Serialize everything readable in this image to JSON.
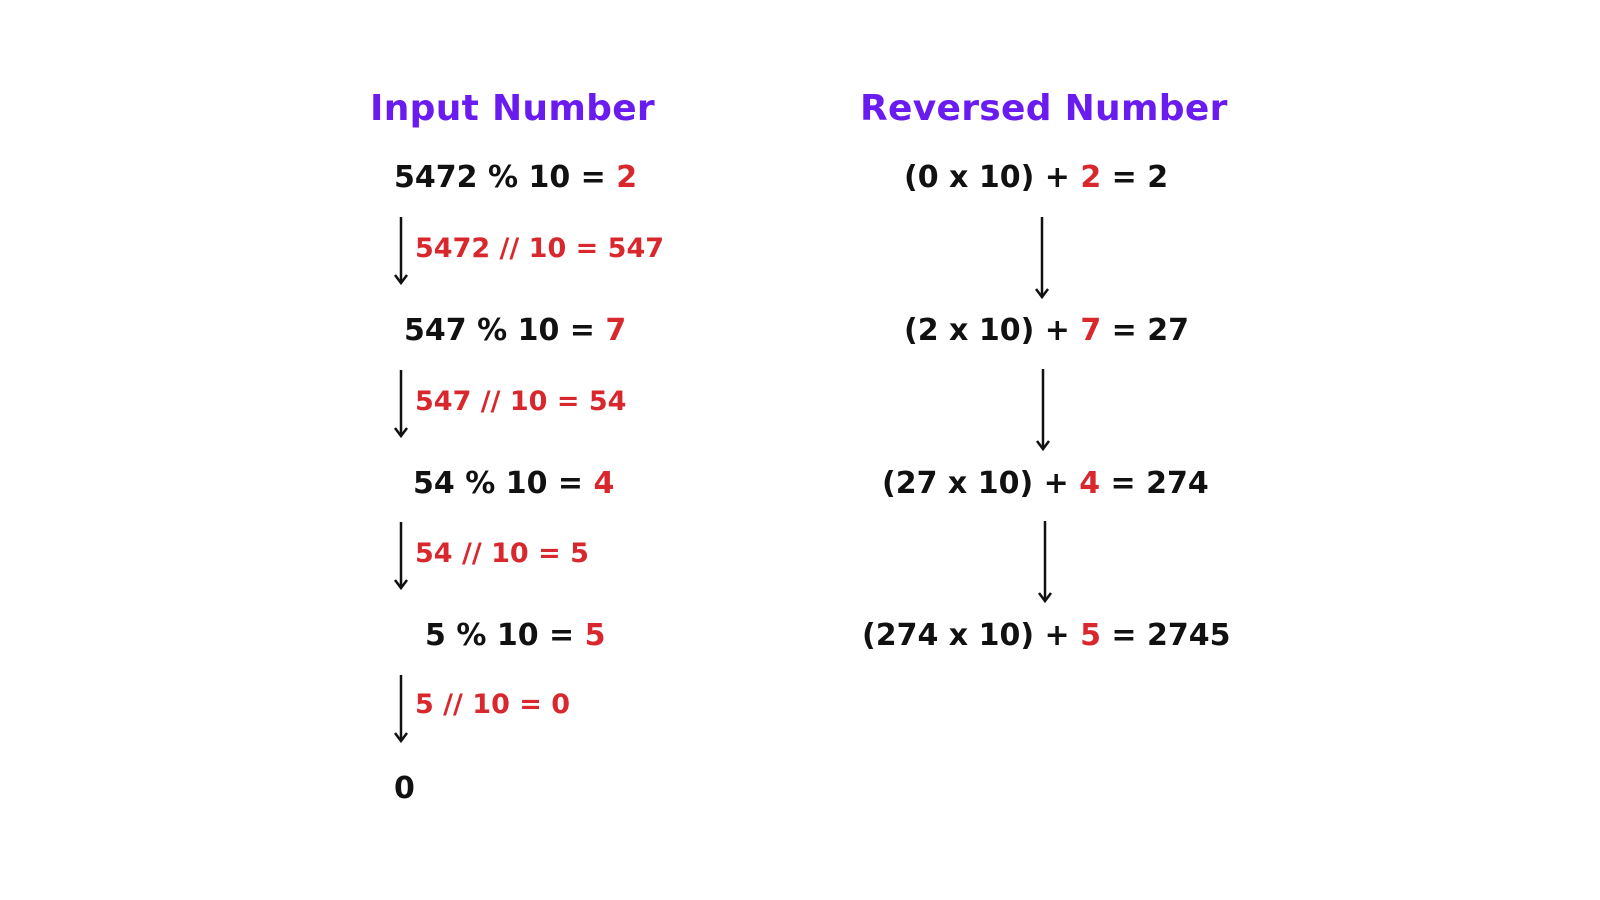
{
  "left": {
    "title": "Input Number",
    "steps": [
      {
        "expr": "5472 % 10 = ",
        "digit": "2",
        "division": "5472 // 10 = 547"
      },
      {
        "expr": "547 % 10 = ",
        "digit": "7",
        "division": "547 // 10 = 54"
      },
      {
        "expr": "54 % 10 = ",
        "digit": "4",
        "division": "54 // 10 = 5"
      },
      {
        "expr": "5 % 10 = ",
        "digit": "5",
        "division": "5 // 10 = 0"
      }
    ],
    "final": "0"
  },
  "right": {
    "title": "Reversed Number",
    "steps": [
      {
        "prefix": "(0 x 10) + ",
        "digit": "2",
        "suffix": " =  2"
      },
      {
        "prefix": "(2 x 10) + ",
        "digit": "7",
        "suffix": " =  27"
      },
      {
        "prefix": "(27 x 10) + ",
        "digit": "4",
        "suffix": " =  274"
      },
      {
        "prefix": "(274 x 10) + ",
        "digit": "5",
        "suffix": " =  2745"
      }
    ]
  },
  "colors": {
    "title": "#6a1bf0",
    "highlight": "#d9272e",
    "text": "#111111"
  }
}
